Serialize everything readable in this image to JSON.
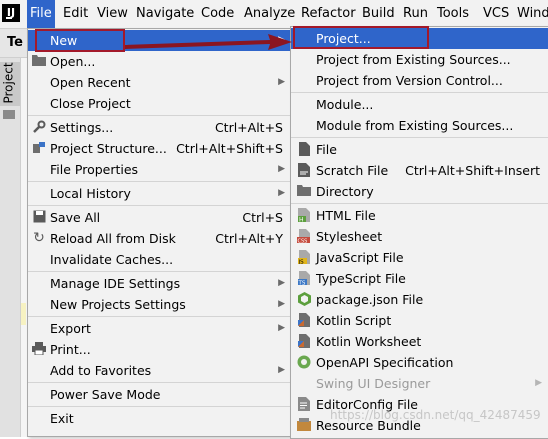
{
  "menubar": {
    "app_icon_text": "IJ",
    "items": [
      "File",
      "Edit",
      "View",
      "Navigate",
      "Code",
      "Analyze",
      "Refactor",
      "Build",
      "Run",
      "Tools",
      "VCS",
      "Windo"
    ],
    "background_tab_fragment": "Te",
    "side_tab_label": "Project"
  },
  "file_menu": {
    "items": [
      {
        "label": "New",
        "shortcut": "",
        "submenu": true,
        "icon": ""
      },
      {
        "label": "Open...",
        "shortcut": "",
        "submenu": false,
        "icon": "folder-icon"
      },
      {
        "label": "Open Recent",
        "shortcut": "",
        "submenu": true,
        "icon": ""
      },
      {
        "label": "Close Project",
        "shortcut": "",
        "submenu": false,
        "icon": ""
      },
      {
        "label": "Settings...",
        "shortcut": "Ctrl+Alt+S",
        "submenu": false,
        "icon": "wrench-icon"
      },
      {
        "label": "Project Structure...",
        "shortcut": "Ctrl+Alt+Shift+S",
        "submenu": false,
        "icon": "project-structure-icon"
      },
      {
        "label": "File Properties",
        "shortcut": "",
        "submenu": true,
        "icon": ""
      },
      {
        "label": "Local History",
        "shortcut": "",
        "submenu": true,
        "icon": ""
      },
      {
        "label": "Save All",
        "shortcut": "Ctrl+S",
        "submenu": false,
        "icon": "save-icon"
      },
      {
        "label": "Reload All from Disk",
        "shortcut": "Ctrl+Alt+Y",
        "submenu": false,
        "icon": "reload-icon"
      },
      {
        "label": "Invalidate Caches...",
        "shortcut": "",
        "submenu": false,
        "icon": ""
      },
      {
        "label": "Manage IDE Settings",
        "shortcut": "",
        "submenu": true,
        "icon": ""
      },
      {
        "label": "New Projects Settings",
        "shortcut": "",
        "submenu": true,
        "icon": ""
      },
      {
        "label": "Export",
        "shortcut": "",
        "submenu": true,
        "icon": ""
      },
      {
        "label": "Print...",
        "shortcut": "",
        "submenu": false,
        "icon": "print-icon"
      },
      {
        "label": "Add to Favorites",
        "shortcut": "",
        "submenu": true,
        "icon": ""
      },
      {
        "label": "Power Save Mode",
        "shortcut": "",
        "submenu": false,
        "icon": ""
      },
      {
        "label": "Exit",
        "shortcut": "",
        "submenu": false,
        "icon": ""
      }
    ]
  },
  "new_menu": {
    "items": [
      {
        "label": "Project...",
        "shortcut": "",
        "icon": "",
        "disabled": false
      },
      {
        "label": "Project from Existing Sources...",
        "shortcut": "",
        "icon": "",
        "disabled": false
      },
      {
        "label": "Project from Version Control...",
        "shortcut": "",
        "icon": "",
        "disabled": false
      },
      {
        "label": "Module...",
        "shortcut": "",
        "icon": "",
        "disabled": false
      },
      {
        "label": "Module from Existing Sources...",
        "shortcut": "",
        "icon": "",
        "disabled": false
      },
      {
        "label": "File",
        "shortcut": "",
        "icon": "file-icon",
        "disabled": false
      },
      {
        "label": "Scratch File",
        "shortcut": "Ctrl+Alt+Shift+Insert",
        "icon": "scratch-file-icon",
        "disabled": false
      },
      {
        "label": "Directory",
        "shortcut": "",
        "icon": "directory-icon",
        "disabled": false
      },
      {
        "label": "HTML File",
        "shortcut": "",
        "icon": "html-file-icon",
        "disabled": false
      },
      {
        "label": "Stylesheet",
        "shortcut": "",
        "icon": "css-file-icon",
        "disabled": false
      },
      {
        "label": "JavaScript File",
        "shortcut": "",
        "icon": "javascript-file-icon",
        "disabled": false
      },
      {
        "label": "TypeScript File",
        "shortcut": "",
        "icon": "typescript-file-icon",
        "disabled": false
      },
      {
        "label": "package.json File",
        "shortcut": "",
        "icon": "package-json-icon",
        "disabled": false
      },
      {
        "label": "Kotlin Script",
        "shortcut": "",
        "icon": "kotlin-script-icon",
        "disabled": false
      },
      {
        "label": "Kotlin Worksheet",
        "shortcut": "",
        "icon": "kotlin-worksheet-icon",
        "disabled": false
      },
      {
        "label": "OpenAPI Specification",
        "shortcut": "",
        "icon": "openapi-icon",
        "disabled": false
      },
      {
        "label": "Swing UI Designer",
        "shortcut": "",
        "icon": "",
        "disabled": true
      },
      {
        "label": "EditorConfig File",
        "shortcut": "",
        "icon": "editorconfig-icon",
        "disabled": false
      },
      {
        "label": "Resource Bundle",
        "shortcut": "",
        "icon": "resource-bundle-icon",
        "disabled": false
      }
    ]
  },
  "watermark": "https://blog.csdn.net/qq_42487459",
  "colors": {
    "highlight": "#2f65ca",
    "menu_background": "#f2f2f2",
    "annotation_red": "#a3192a"
  }
}
